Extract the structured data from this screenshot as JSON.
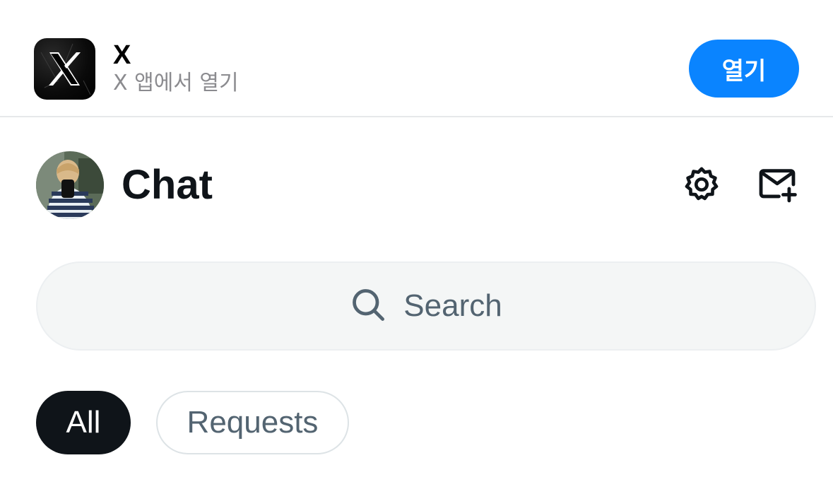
{
  "banner": {
    "app_name": "X",
    "subtitle": "X 앱에서 열기",
    "open_label": "열기",
    "icon": "x-logo-icon",
    "accent": "#0a84ff"
  },
  "header": {
    "title": "Chat",
    "avatar": "profile-avatar",
    "actions": [
      {
        "icon": "gear-icon"
      },
      {
        "icon": "compose-message-icon"
      }
    ]
  },
  "search": {
    "placeholder": "Search",
    "icon": "search-icon"
  },
  "tabs": [
    {
      "label": "All",
      "active": true
    },
    {
      "label": "Requests",
      "active": false
    }
  ],
  "colors": {
    "text": "#0f1419",
    "muted": "#536471",
    "search_bg": "#f4f6f6",
    "active_tab_bg": "#0f1419"
  }
}
